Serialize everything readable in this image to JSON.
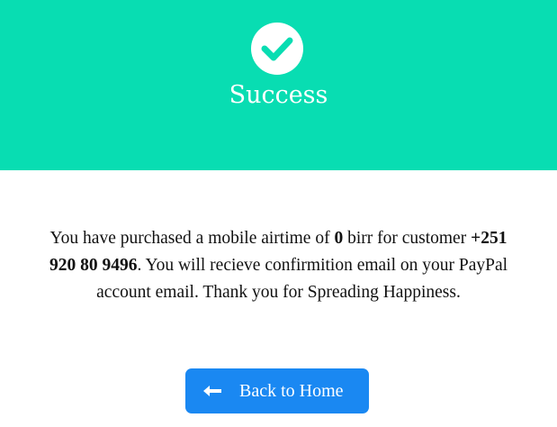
{
  "header": {
    "title": "Success",
    "icon": "check-circle-icon",
    "background_color": "#08ddb2"
  },
  "message": {
    "part1": "You have purchased a mobile airtime of ",
    "amount": "0",
    "part2": " birr for customer ",
    "phone": "+251 920 80 9496",
    "part3": ". You will recieve confirmition email on your PayPal account email. Thank you for Spreading Happiness."
  },
  "back_button": {
    "label": "Back to Home",
    "icon": "arrow-left-icon",
    "color": "#1a88f2"
  }
}
